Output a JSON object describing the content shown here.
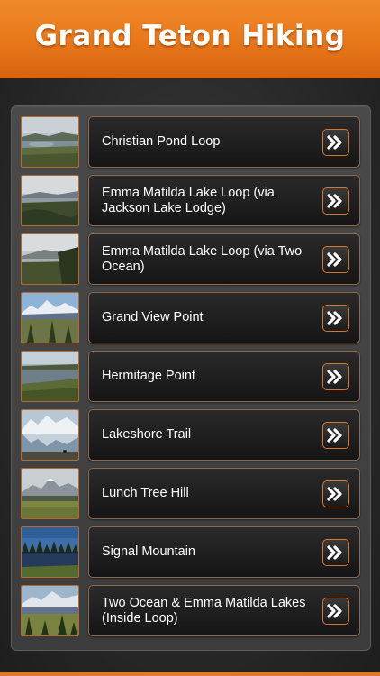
{
  "header": {
    "title": "Grand Teton Hiking"
  },
  "trails": [
    {
      "label": "Christian Pond Loop",
      "thumbnail": "pond-landscape"
    },
    {
      "label": "Emma Matilda Lake Loop (via Jackson Lake Lodge)",
      "thumbnail": "lake-forest-view"
    },
    {
      "label": "Emma Matilda Lake Loop (via Two Ocean)",
      "thumbnail": "lake-hillside-view"
    },
    {
      "label": "Grand View Point",
      "thumbnail": "mountain-view"
    },
    {
      "label": "Hermitage Point",
      "thumbnail": "lake-shore"
    },
    {
      "label": "Lakeshore Trail",
      "thumbnail": "lake-mountain-reflection"
    },
    {
      "label": "Lunch Tree Hill",
      "thumbnail": "mountain-meadow"
    },
    {
      "label": "Signal Mountain",
      "thumbnail": "forest-lake"
    },
    {
      "label": "Two Ocean & Emma Matilda Lakes (Inside Loop)",
      "thumbnail": "mountain-trees"
    }
  ],
  "colors": {
    "accent": "#e8771a",
    "card_border": "#8a6a50",
    "button_border": "#d9752a"
  },
  "icons": {
    "go": "double-chevron-right-icon"
  }
}
